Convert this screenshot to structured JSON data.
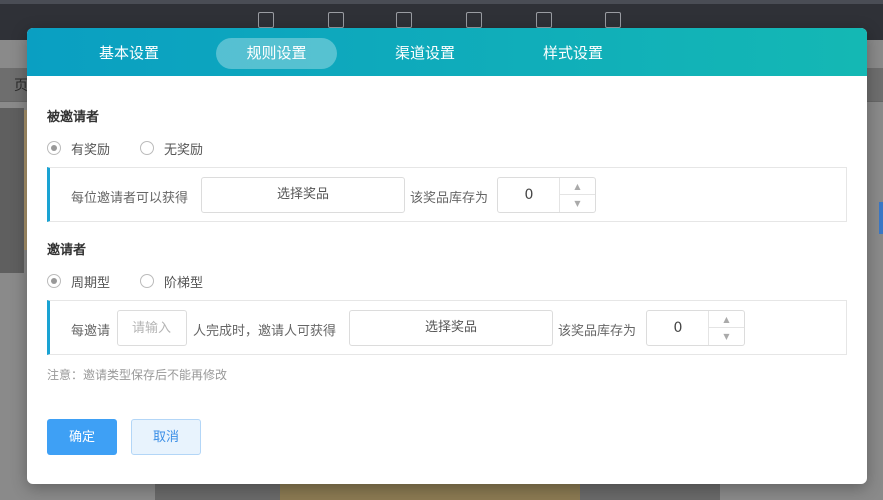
{
  "background": {
    "nav_text": "页"
  },
  "modal": {
    "tabs": [
      {
        "label": "基本设置",
        "active": false
      },
      {
        "label": "规则设置",
        "active": true
      },
      {
        "label": "渠道设置",
        "active": false
      },
      {
        "label": "样式设置",
        "active": false
      }
    ],
    "invitee": {
      "title": "被邀请者",
      "options": [
        {
          "label": "有奖励",
          "checked": true
        },
        {
          "label": "无奖励",
          "checked": false
        }
      ],
      "panel": {
        "prefix": "每位邀请者可以获得",
        "select_label": "选择奖品",
        "stock_label": "该奖品库存为",
        "stock_value": "0"
      }
    },
    "inviter": {
      "title": "邀请者",
      "options": [
        {
          "label": "周期型",
          "checked": true
        },
        {
          "label": "阶梯型",
          "checked": false
        }
      ],
      "panel": {
        "prefix": "每邀请",
        "count_placeholder": "请输入",
        "middle": "人完成时，邀请人可获得",
        "select_label": "选择奖品",
        "stock_label": "该奖品库存为",
        "stock_value": "0"
      }
    },
    "note": "注意：邀请类型保存后不能再修改",
    "confirm_label": "确定",
    "cancel_label": "取消"
  },
  "colors": {
    "header_start": "#0a9fc2",
    "header_end": "#14b8b4",
    "accent_bar": "#1aa3d3",
    "primary_button": "#3ea0f5"
  }
}
